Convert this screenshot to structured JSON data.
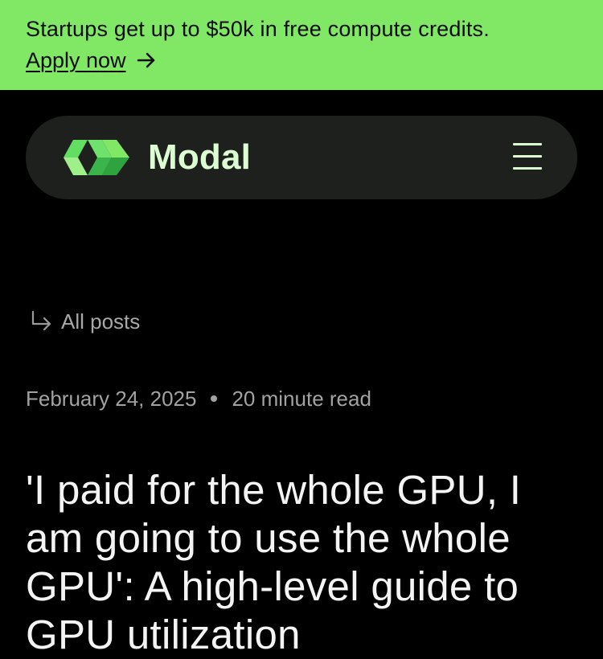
{
  "banner": {
    "text": "Startups get up to $50k in free compute credits.",
    "link_label": "Apply now",
    "background": "#80E865",
    "arrow_icon": "arrow-right-icon"
  },
  "nav": {
    "brand": "Modal",
    "logo_icon": "modal-logo-icon",
    "menu_icon": "hamburger-menu-icon",
    "background": "#1e201e"
  },
  "post": {
    "back_label": "All posts",
    "back_icon": "return-arrow-icon",
    "date": "February 24, 2025",
    "read_time": "20 minute read",
    "title": "'I paid for the whole GPU, I am going to use the whole GPU': A high-level guide to GPU utilization"
  }
}
